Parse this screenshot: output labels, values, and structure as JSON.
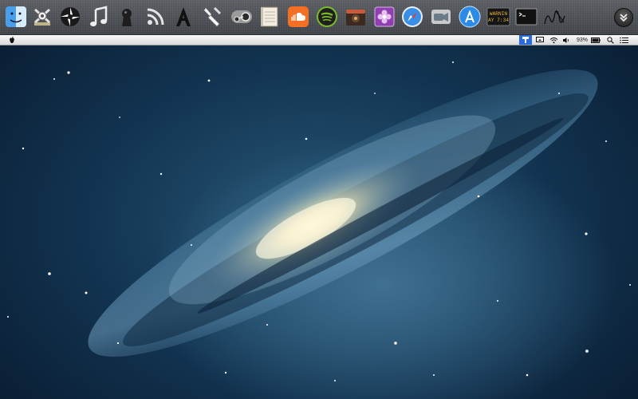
{
  "dock": {
    "apps": [
      {
        "id": "finder",
        "icon": "finder-icon"
      },
      {
        "id": "utility",
        "icon": "crossed-tools-icon"
      },
      {
        "id": "shutter",
        "icon": "aperture-icon"
      },
      {
        "id": "music",
        "icon": "music-note-icon"
      },
      {
        "id": "keyhole",
        "icon": "keyhole-icon"
      },
      {
        "id": "rss",
        "icon": "rss-icon"
      },
      {
        "id": "typography",
        "icon": "letter-a-icon"
      },
      {
        "id": "tweaks",
        "icon": "wrench-icon"
      },
      {
        "id": "steam",
        "icon": "steam-icon"
      },
      {
        "id": "notes",
        "icon": "notebook-icon"
      },
      {
        "id": "soundcloud",
        "icon": "soundcloud-icon"
      },
      {
        "id": "spotify",
        "icon": "spotify-icon"
      },
      {
        "id": "media",
        "icon": "media-box-icon"
      },
      {
        "id": "design",
        "icon": "pink-flower-icon"
      },
      {
        "id": "safari",
        "icon": "safari-compass-icon"
      },
      {
        "id": "facetime",
        "icon": "video-camera-icon"
      },
      {
        "id": "appstore",
        "icon": "app-store-icon"
      },
      {
        "id": "console",
        "icon": "console-warning-icon",
        "lines": [
          "WARNIN",
          "AY 7:34"
        ]
      },
      {
        "id": "terminal",
        "icon": "terminal-icon"
      },
      {
        "id": "signature",
        "icon": "signature-icon"
      }
    ],
    "overflow_icon": "double-chevron-down-icon"
  },
  "menubar": {
    "apple_icon": "apple-icon",
    "status_icons": [
      "active-menu-icon",
      "display-icon",
      "wifi-icon",
      "volume-icon"
    ],
    "battery_percent": "93%",
    "battery_icon": "battery-icon",
    "spotlight_icon": "spotlight-search-icon",
    "list_icon": "notification-list-icon"
  },
  "colors": {
    "accent": "#2a6ce0",
    "soundcloud": "#f26f23",
    "spotify": "#7bbb2a",
    "safari": "#3a8ee6",
    "app_store": "#2d8be8"
  }
}
